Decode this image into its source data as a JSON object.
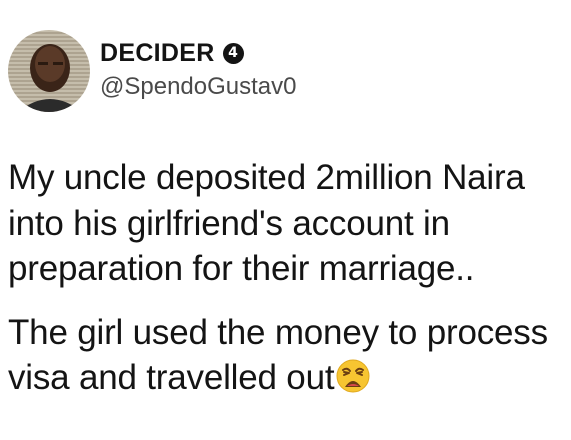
{
  "user": {
    "display_name": "DECIDER",
    "badge": "4",
    "handle": "@SpendoGustav0",
    "avatar_icon": "profile-photo"
  },
  "tweet": {
    "paragraph1_lines": [
      "My uncle deposited 2million Naira",
      "into his girlfriend's account in",
      "preparation for their marriage.."
    ],
    "paragraph2_lines": [
      "The girl used the money to process",
      "visa and travelled out"
    ],
    "emoji": "weary-face-emoji"
  },
  "colors": {
    "text": "#141414",
    "handle": "#4a4a4a",
    "emoji_fill": "#f7c531"
  }
}
